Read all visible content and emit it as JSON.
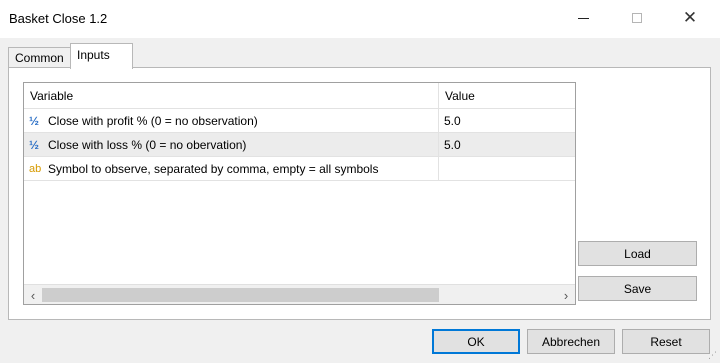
{
  "window": {
    "title": "Basket Close 1.2",
    "minimize_icon": "minimize-icon",
    "maximize_icon": "maximize-icon",
    "close_glyph": "✕"
  },
  "tabs": [
    {
      "label": "Common"
    },
    {
      "label": "Inputs",
      "active": true
    }
  ],
  "grid": {
    "headers": {
      "variable": "Variable",
      "value": "Value"
    },
    "rows": [
      {
        "type_icon": "½",
        "icon_name": "numeric-type-icon",
        "variable": "Close with profit % (0 = no observation)",
        "value": "5.0"
      },
      {
        "type_icon": "½",
        "icon_name": "numeric-type-icon",
        "variable": "Close with loss % (0 = no obervation)",
        "value": "5.0"
      },
      {
        "type_icon": "ab",
        "icon_name": "string-type-icon",
        "variable": "Symbol to observe, separated by comma, empty = all symbols",
        "value": ""
      }
    ],
    "scroll_left": "‹",
    "scroll_right": "›"
  },
  "side_buttons": {
    "load": "Load",
    "save": "Save"
  },
  "footer_buttons": {
    "ok": "OK",
    "cancel": "Abbrechen",
    "reset": "Reset"
  },
  "colors": {
    "numeric_icon": "#2b6fc6",
    "string_icon": "#d69a00",
    "selected_row": "#ececec",
    "default_button_border": "#0078d7"
  }
}
